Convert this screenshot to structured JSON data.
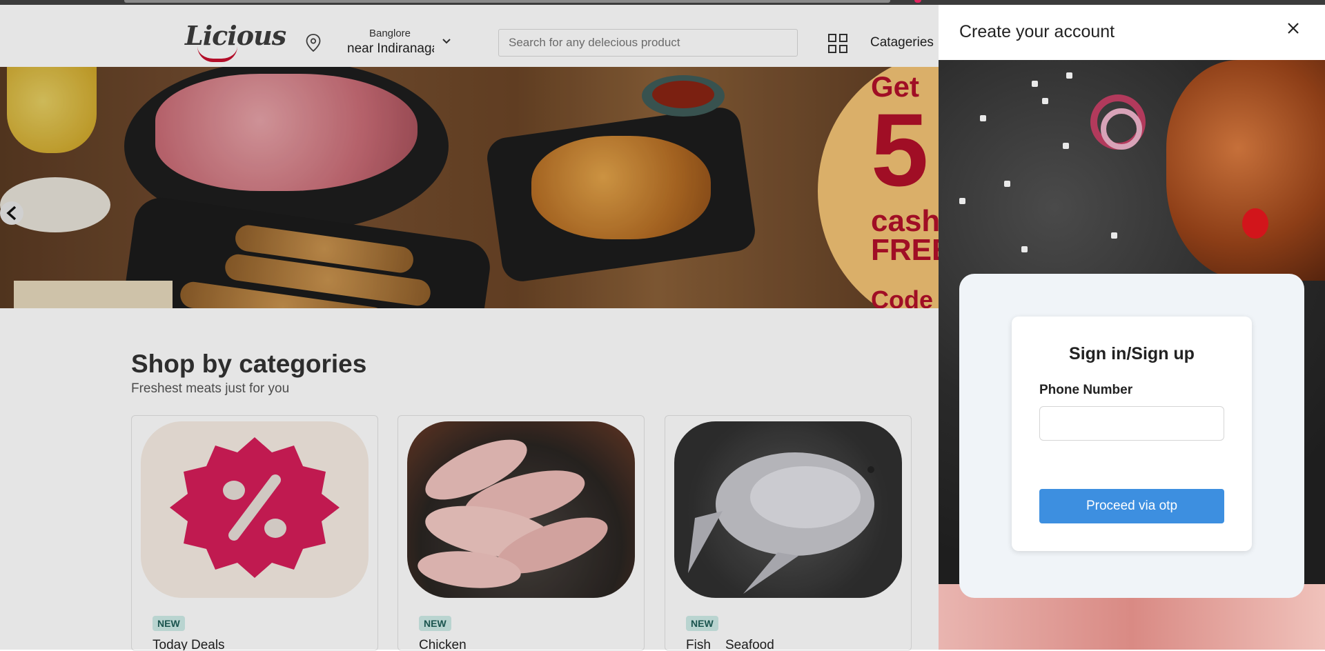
{
  "header": {
    "logo_text": "Licious",
    "location_city": "Banglore",
    "location_area": "near Indiranagar",
    "search_placeholder": "Search for any delecious product",
    "categories_label": "Catageries"
  },
  "banner": {
    "promo_line1": "Get",
    "promo_line2": "5",
    "promo_line3": "cash",
    "promo_line4": "FREE",
    "promo_line5": "Code"
  },
  "section": {
    "title": "Shop by categories",
    "subtitle": "Freshest meats just for you"
  },
  "categories": [
    {
      "badge": "NEW",
      "name": "Today Deals"
    },
    {
      "badge": "NEW",
      "name": "Chicken"
    },
    {
      "badge": "NEW",
      "name": "Fish    Seafood"
    }
  ],
  "drawer": {
    "title": "Create your account",
    "signin_title": "Sign in/Sign up",
    "phone_label": "Phone Number",
    "phone_value": "",
    "proceed_label": "Proceed via otp"
  },
  "colors": {
    "brand_red": "#c8102e",
    "button_blue": "#3d8fe0",
    "badge_bg": "#cfece8"
  }
}
